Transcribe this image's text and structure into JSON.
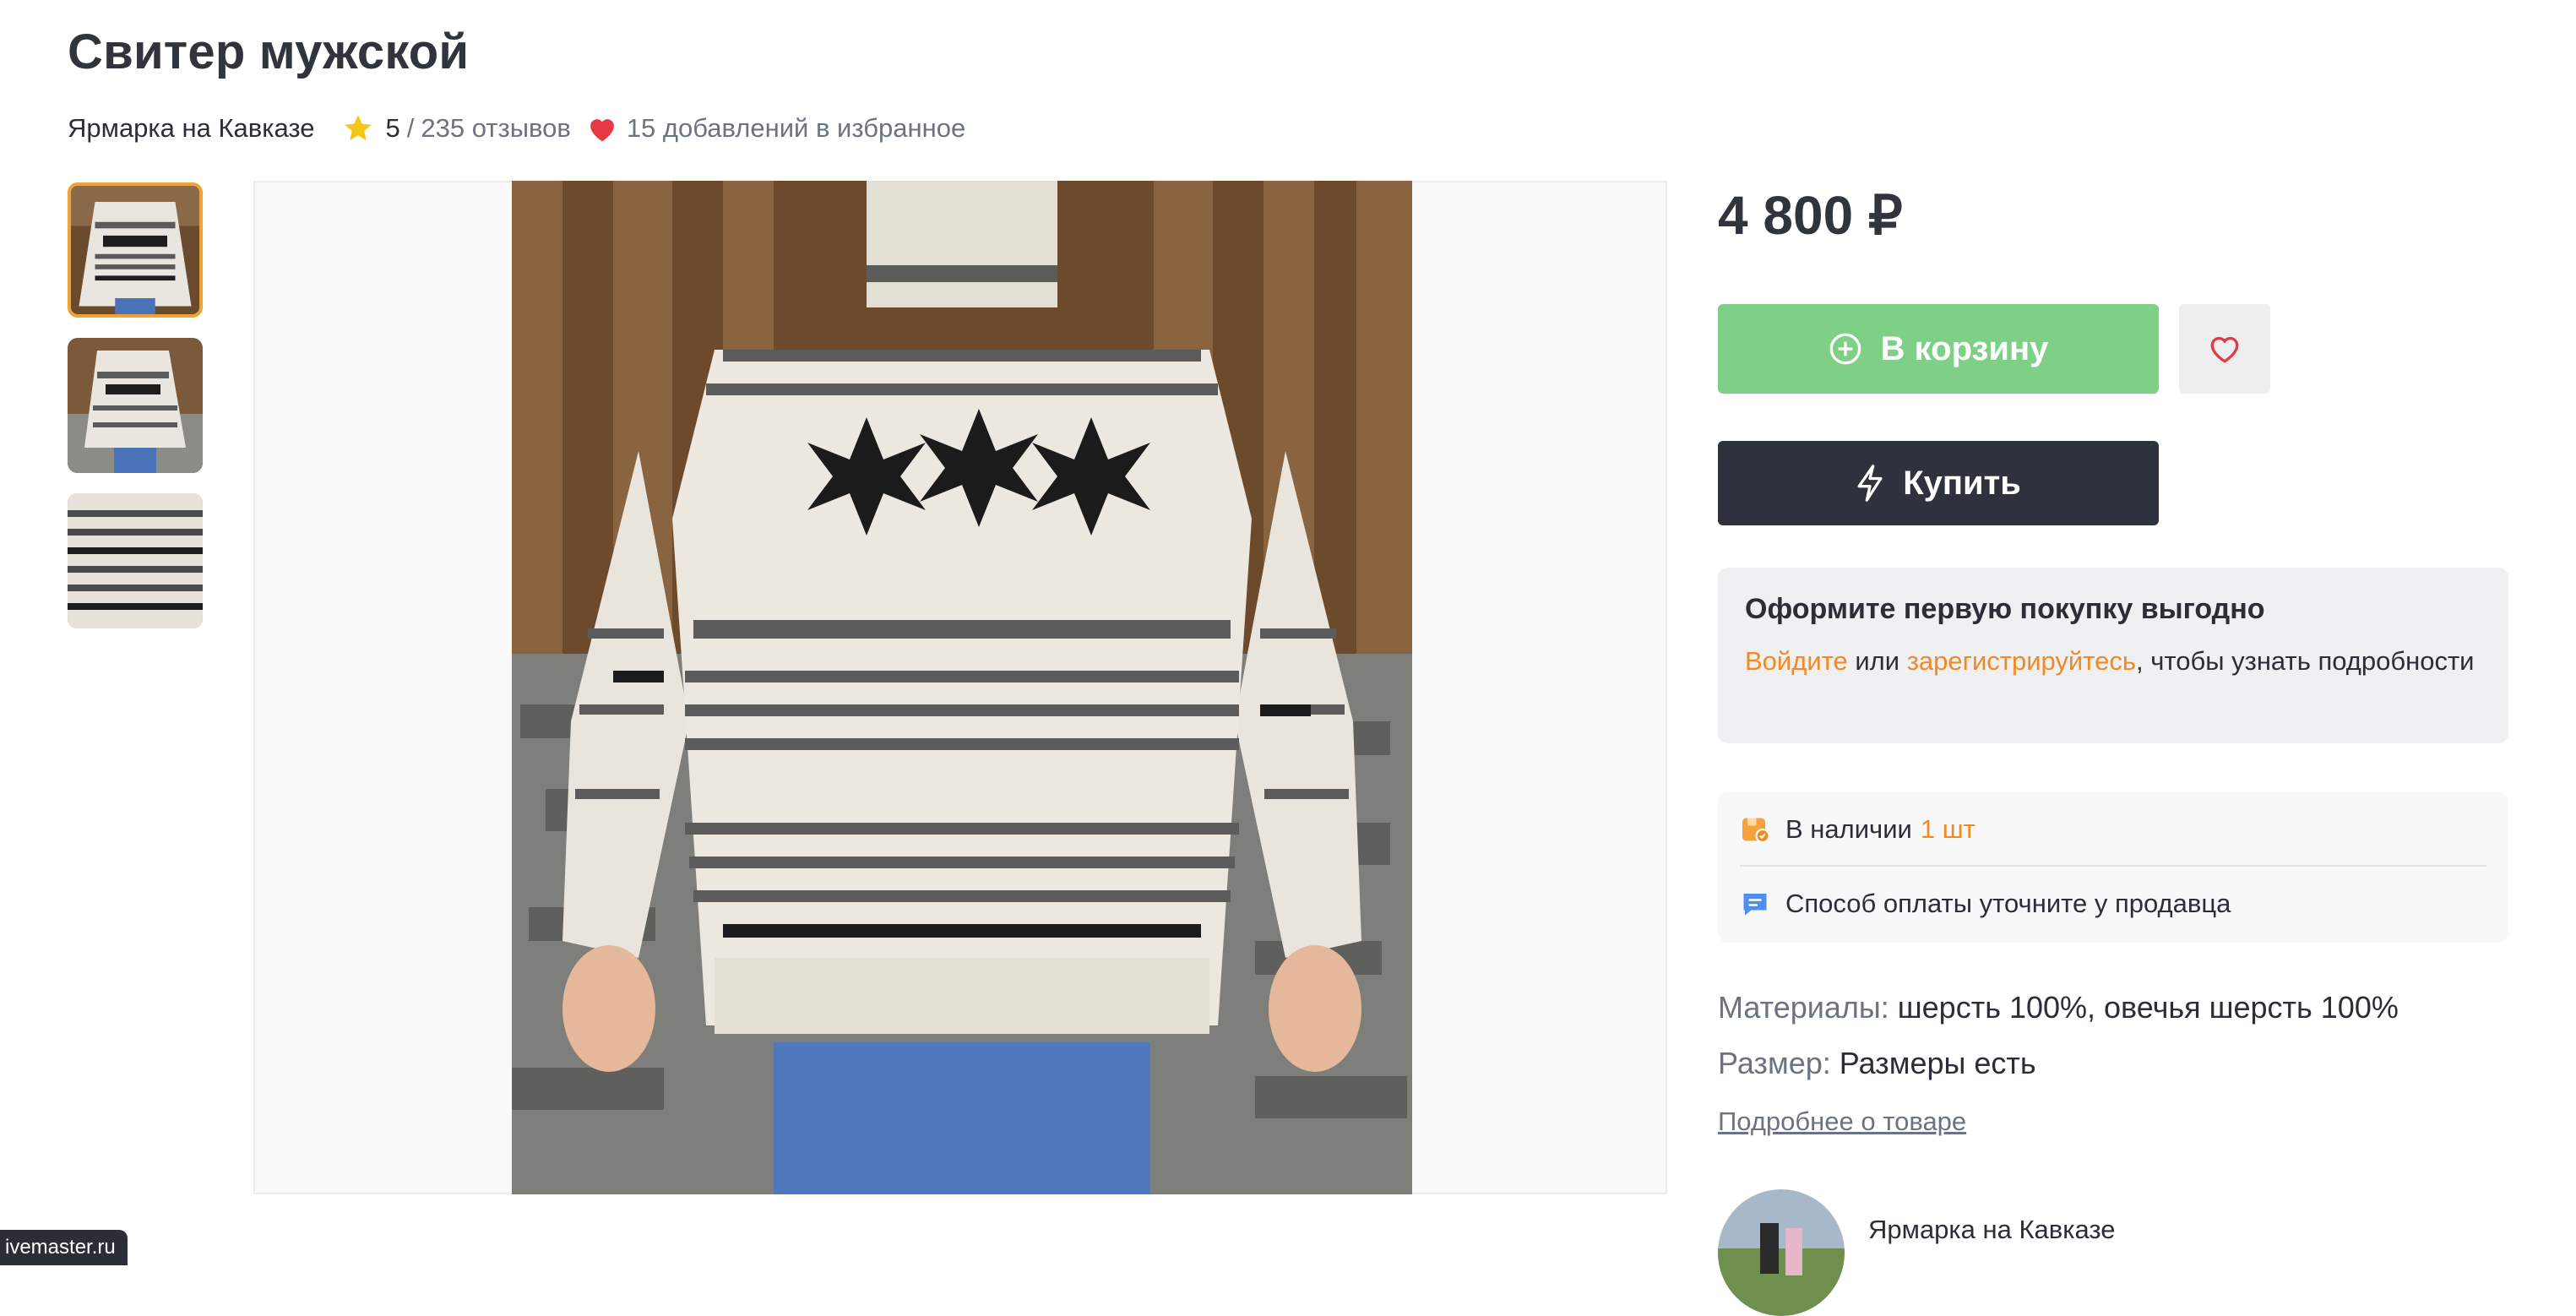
{
  "product": {
    "title": "Свитер мужской",
    "shop": "Ярмарка на Кавказе",
    "rating": "5",
    "rating_sep": "/",
    "reviews": "235 отзывов",
    "favorites": "15 добавлений в избранное"
  },
  "price": "4 800 ₽",
  "buttons": {
    "cart": "В корзину",
    "buy": "Купить"
  },
  "promo": {
    "heading": "Оформите первую покупку выгодно",
    "login": "Войдите",
    "or": "или",
    "register": "зарегистрируйтесь",
    "rest": ", чтобы узнать подробности"
  },
  "availability": {
    "label": "В наличии",
    "count": "1 шт",
    "payment": "Способ оплаты уточните у продавца"
  },
  "attributes": [
    {
      "label": "Материалы:",
      "value": "шерсть 100%, овечья шерсть 100%"
    },
    {
      "label": "Размер:",
      "value": "Размеры есть"
    }
  ],
  "more_link": "Подробнее о товаре",
  "seller": {
    "name": "Ярмарка на Кавказе"
  },
  "watermark": "ivemaster.ru",
  "colors": {
    "accent": "#f08a24",
    "cart_button": "#7fd087",
    "buy_button": "#2d323d",
    "star": "#f5c518",
    "heart": "#e63946"
  },
  "icons": [
    "star-icon",
    "heart-icon",
    "plus-circle-icon",
    "heart-outline-icon",
    "lightning-icon",
    "box-icon",
    "chat-icon"
  ]
}
